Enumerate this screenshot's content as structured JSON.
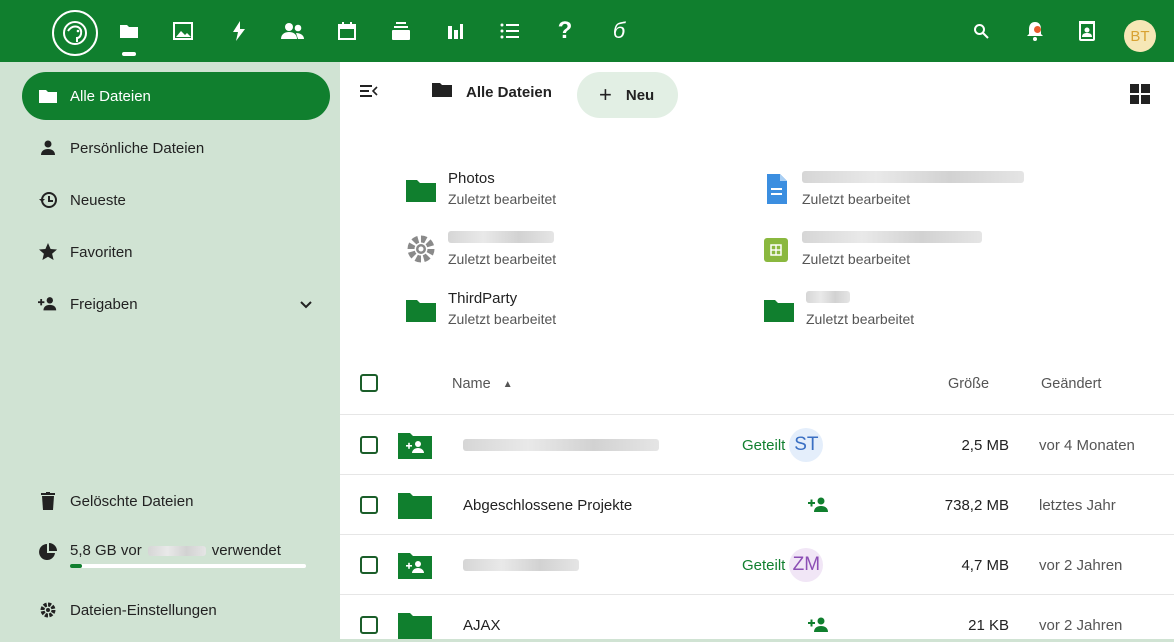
{
  "topbar": {
    "apps": [
      "files-app-icon",
      "photos-app-icon",
      "activity-app-icon",
      "contacts-app-icon",
      "calendar-app-icon",
      "deck-app-icon",
      "analytics-app-icon",
      "tasks-app-icon",
      "help-app-icon",
      "notes-app-icon"
    ],
    "user_initials": "BT"
  },
  "sidebar": {
    "items": [
      {
        "label": "Alle Dateien",
        "icon": "folder-icon"
      },
      {
        "label": "Persönliche Dateien",
        "icon": "person-icon"
      },
      {
        "label": "Neueste",
        "icon": "history-icon"
      },
      {
        "label": "Favoriten",
        "icon": "star-icon"
      },
      {
        "label": "Freigaben",
        "icon": "share-icon"
      }
    ],
    "bottom": {
      "trash": "Gelöschte Dateien",
      "quota_prefix": "5,8 GB vor",
      "quota_suffix": "verwendet",
      "quota_fraction": 0.05,
      "settings": "Dateien-Einstellungen"
    }
  },
  "main": {
    "breadcrumb": "Alle Dateien",
    "new_button": "Neu",
    "new_plus": "+",
    "recent": [
      {
        "name": "Photos",
        "sub": "Zuletzt bearbeitet",
        "icon": "folder-icon"
      },
      {
        "name": "",
        "sub": "Zuletzt bearbeitet",
        "icon": "document-icon"
      },
      {
        "name": "",
        "sub": "Zuletzt bearbeitet",
        "icon": "gear-icon"
      },
      {
        "name": "",
        "sub": "Zuletzt bearbeitet",
        "icon": "spreadsheet-icon"
      },
      {
        "name": "ThirdParty",
        "sub": "Zuletzt bearbeitet",
        "icon": "folder-icon"
      },
      {
        "name": "",
        "sub": "Zuletzt bearbeitet",
        "icon": "folder-icon"
      }
    ],
    "table": {
      "col_name": "Name",
      "col_size": "Größe",
      "col_modified": "Geändert",
      "rows": [
        {
          "name": "",
          "shared": "Geteilt",
          "avatar": "ST",
          "avatar_bg": "#e4eefb",
          "avatar_fg": "#3a6fc3",
          "size": "2,5 MB",
          "modified": "vor 4 Monaten",
          "type": "shared-folder"
        },
        {
          "name": "Abgeschlossene Projekte",
          "shared": "",
          "avatar": "",
          "size": "738,2 MB",
          "modified": "letztes Jahr",
          "type": "folder"
        },
        {
          "name": "",
          "shared": "Geteilt",
          "avatar": "ZM",
          "avatar_bg": "#f1e6f6",
          "avatar_fg": "#8c4fb5",
          "size": "4,7 MB",
          "modified": "vor 2 Jahren",
          "type": "shared-folder"
        },
        {
          "name": "AJAX",
          "shared": "",
          "avatar": "",
          "size": "21 KB",
          "modified": "vor 2 Jahren",
          "type": "folder"
        }
      ],
      "more": "•••"
    }
  },
  "colors": {
    "brand": "#107f2e",
    "sidebar_bg": "#d0e3d3"
  }
}
